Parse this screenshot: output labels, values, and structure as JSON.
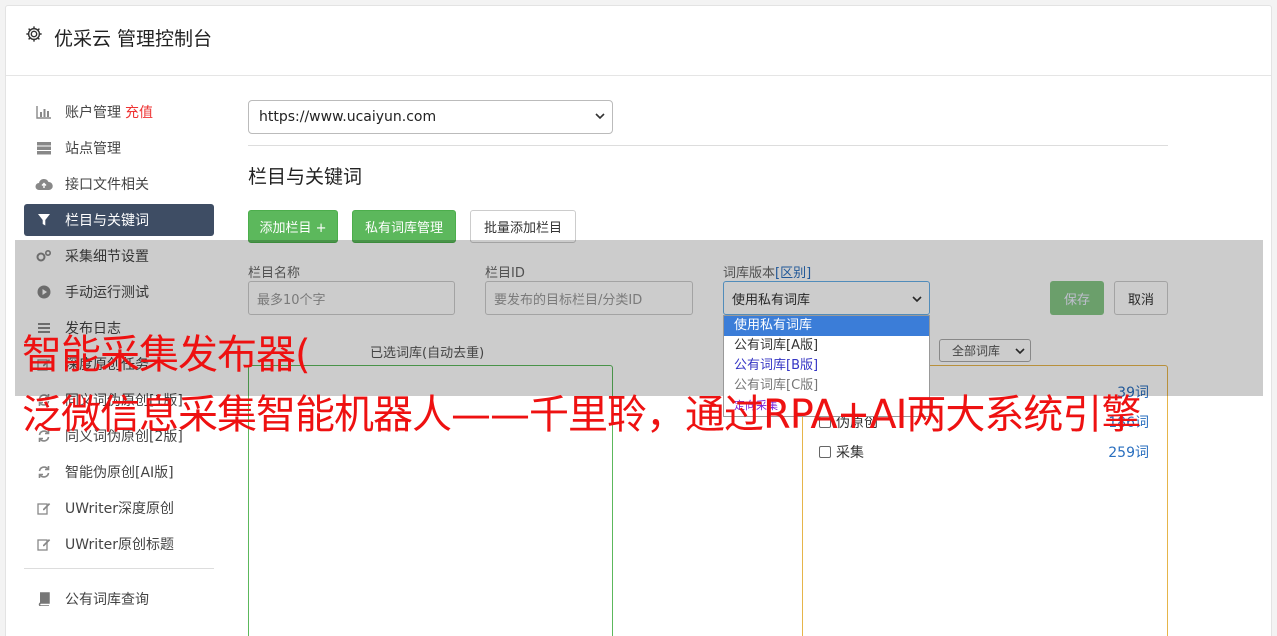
{
  "header": {
    "title": "优采云 管理控制台",
    "icon": "gear-icon"
  },
  "sidebar": {
    "items": [
      {
        "label": "账户管理",
        "badge": "充值",
        "icon": "bar-chart-icon"
      },
      {
        "label": "站点管理",
        "icon": "server-icon"
      },
      {
        "label": "接口文件相关",
        "icon": "cloud-upload-icon"
      },
      {
        "label": "栏目与关键词",
        "icon": "filter-icon",
        "active": true
      },
      {
        "label": "采集细节设置",
        "icon": "cogs-icon"
      },
      {
        "label": "手动运行测试",
        "icon": "play-circle-icon"
      },
      {
        "label": "发布日志",
        "icon": "list-icon"
      },
      {
        "label": "深度原创任务",
        "icon": "edit-icon"
      },
      {
        "label": "同义词伪原创[1版]",
        "icon": "refresh-icon"
      },
      {
        "label": "同义词伪原创[2版]",
        "icon": "refresh-icon"
      },
      {
        "label": "智能伪原创[AI版]",
        "icon": "refresh-icon"
      },
      {
        "label": "UWriter深度原创",
        "icon": "edit-icon"
      },
      {
        "label": "UWriter原创标题",
        "icon": "edit-icon"
      },
      {
        "label": "公有词库查询",
        "icon": "book-icon"
      }
    ]
  },
  "main": {
    "site_select": "https://www.ucaiyun.com",
    "section_title": "栏目与关键词",
    "buttons": {
      "add_column": "添加栏目 +",
      "private_lib": "私有词库管理",
      "batch_add": "批量添加栏目"
    },
    "form": {
      "name_label": "栏目名称",
      "name_placeholder": "最多10个字",
      "id_label": "栏目ID",
      "id_placeholder": "要发布的目标栏目/分类ID",
      "version_label": "词库版本",
      "version_link": "[区别]",
      "version_value": "使用私有词库",
      "save": "保存",
      "cancel": "取消"
    },
    "dropdown_options": [
      "使用私有词库",
      "公有词库[A版]",
      "公有词库[B版]",
      "公有词库[C版]",
      "定向采集"
    ],
    "selected_label": "已选词库(自动去重)",
    "lib_filter": "全部词库",
    "libraries": [
      {
        "name": "",
        "count": "39词"
      },
      {
        "name": "伪原创",
        "count": "186词"
      },
      {
        "name": "采集",
        "count": "259词"
      }
    ]
  },
  "watermark": {
    "line1": "智能采集发布器(",
    "line2": "泛微信息采集智能机器人——千里聆，通过RPA+AI两大系统引擎"
  },
  "colors": {
    "accent_green": "#5cb85c",
    "active_nav": "#3e4d64",
    "watermark_red": "#ee1111"
  }
}
